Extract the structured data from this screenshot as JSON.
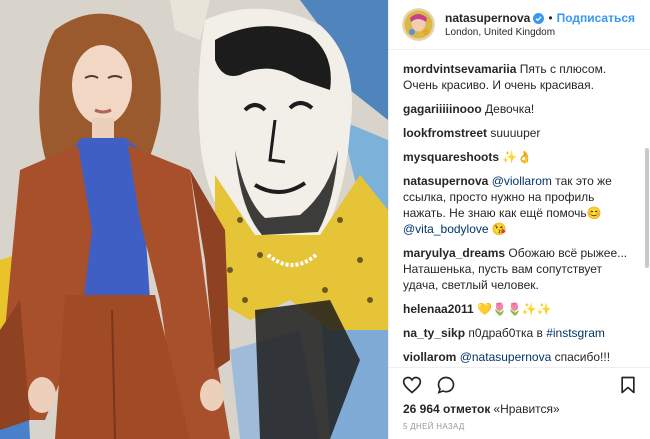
{
  "header": {
    "username": "natasupernova",
    "follow_label": "Подписаться",
    "separator": "•",
    "location": "London, United Kingdom"
  },
  "comments": [
    {
      "user": "mordvintsevamariia",
      "text": "Пять с плюсом. Очень красиво. И очень красивая."
    },
    {
      "user": "gagariiiiinooo",
      "text": "Девочка!"
    },
    {
      "user": "lookfromstreet",
      "text": "suuuuper"
    },
    {
      "user": "mysquareshoots",
      "text": "✨👌"
    },
    {
      "user": "natasupernova",
      "mention1": "@viollarom",
      "text": "так это же ссылка, просто нужно на профиль нажать. Не знаю как ещё помочь",
      "emoji": "😊",
      "mention2": "@vita_bodylove",
      "emoji2": "😘"
    },
    {
      "user": "maryulya_dreams",
      "text": "Обожаю всё рыжее... Наташенька, пусть вам сопутствует удача, светлый человек."
    },
    {
      "user": "helenaa2011",
      "text": "💛🌷🌷✨✨"
    },
    {
      "user": "na_ty_sikp",
      "text": "п0драб0тка в",
      "hashtag": "#instsgram"
    },
    {
      "user": "viollarom",
      "mention1": "@natasupernova",
      "text": "спасибо!!! Видимо на данный момент у профиля проблемы, пишет нет публикаций, нет подписок и т.п.. может Инстаграмм"
    }
  ],
  "actions": {
    "like": "heart-icon",
    "comment": "comment-icon",
    "save": "bookmark-icon"
  },
  "likes": {
    "count": "26 964 отметок",
    "label": "«Нравится»"
  },
  "timestamp": "5 дней назад",
  "colors": {
    "follow": "#3897f0",
    "mention": "#003569",
    "verified": "#3897f0",
    "jacket": "#a8502b",
    "top": "#3f5fc4"
  }
}
